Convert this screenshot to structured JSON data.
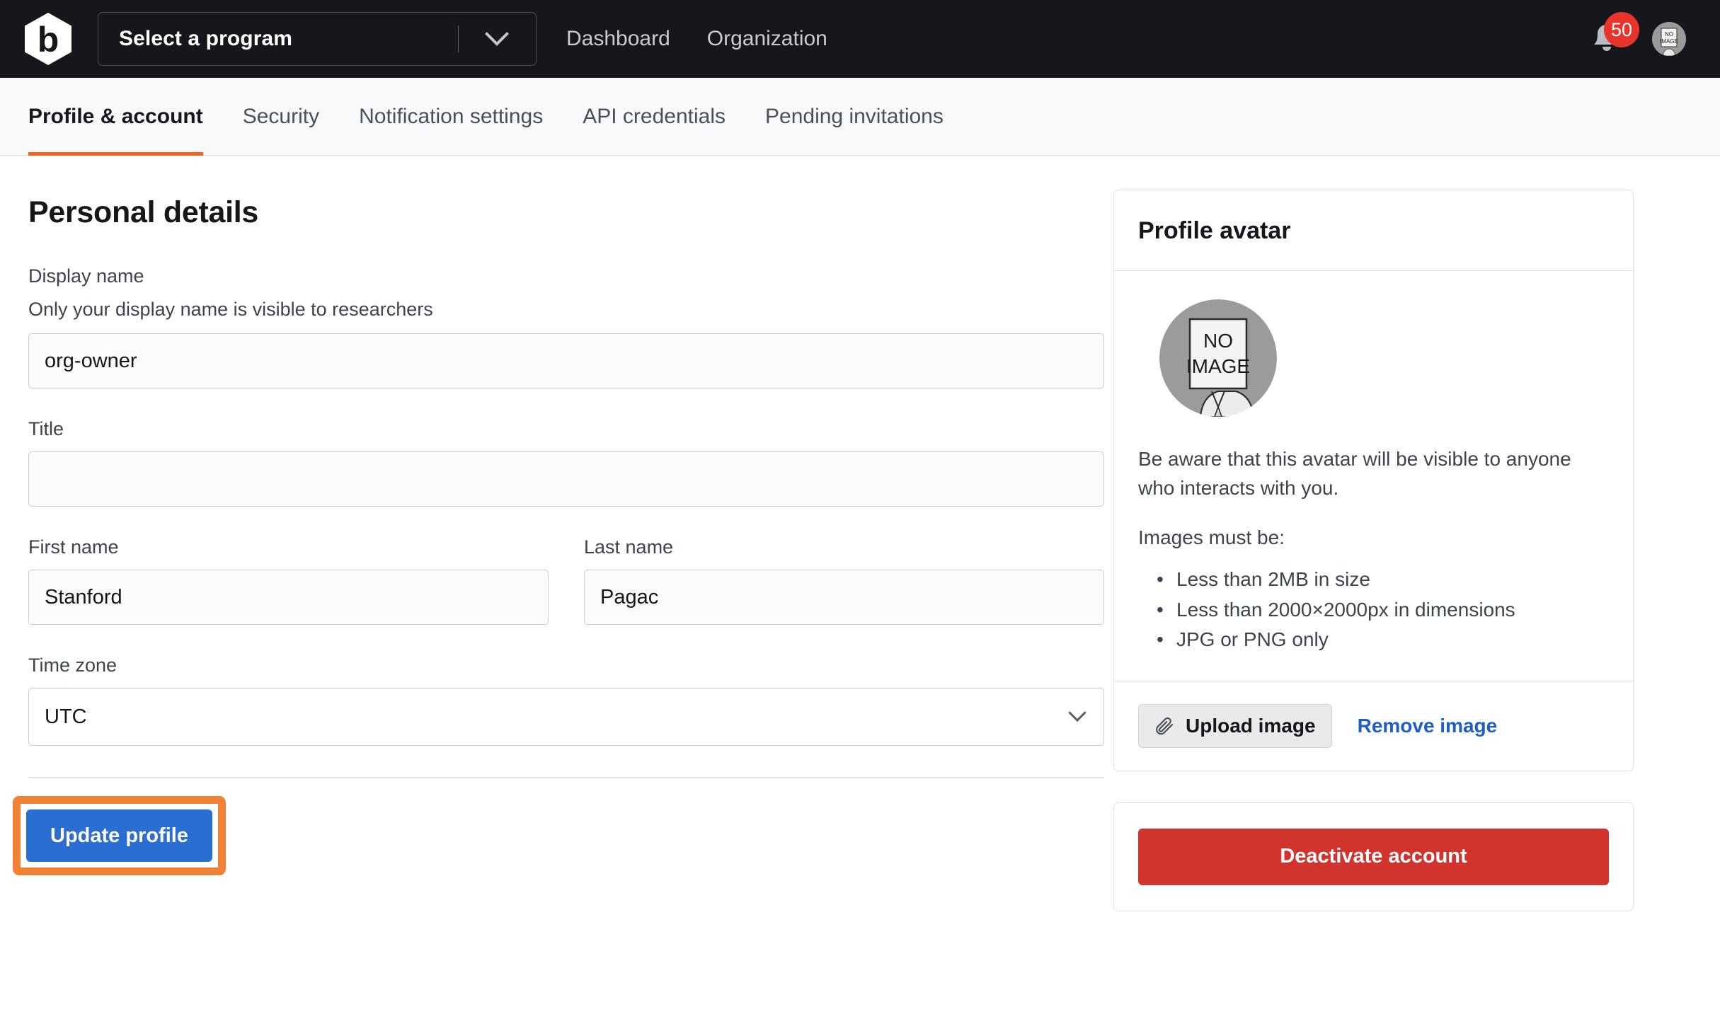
{
  "topbar": {
    "logo_icon": "bugcrowd-hexagon-b-logo",
    "program_select": {
      "label": "Select a program",
      "chevron_icon": "chevron-down-icon"
    },
    "nav": [
      {
        "label": "Dashboard"
      },
      {
        "label": "Organization"
      }
    ],
    "notifications": {
      "icon": "bell-icon",
      "count": "50"
    },
    "avatar": {
      "icon": "user-avatar-no-image",
      "alt_line1": "NO",
      "alt_line2": "IMAGE"
    }
  },
  "tabs": [
    {
      "label": "Profile & account",
      "active": true
    },
    {
      "label": "Security",
      "active": false
    },
    {
      "label": "Notification settings",
      "active": false
    },
    {
      "label": "API credentials",
      "active": false
    },
    {
      "label": "Pending invitations",
      "active": false
    }
  ],
  "accent": {
    "tab_underline": "#f26322",
    "highlight": "#f08135",
    "primary_button": "#2a6ed1",
    "danger_button": "#d0342c",
    "link": "#1f5fc4",
    "badge": "#e8342a"
  },
  "personal_details": {
    "heading": "Personal details",
    "display_name": {
      "label": "Display name",
      "hint": "Only your display name is visible to researchers",
      "value": "org-owner",
      "placeholder": ""
    },
    "title": {
      "label": "Title",
      "value": "",
      "placeholder": ""
    },
    "first_name": {
      "label": "First name",
      "value": "Stanford",
      "placeholder": ""
    },
    "last_name": {
      "label": "Last name",
      "value": "Pagac",
      "placeholder": ""
    },
    "time_zone": {
      "label": "Time zone",
      "value": "UTC",
      "chevron_icon": "chevron-down-icon"
    },
    "submit_label": "Update profile"
  },
  "profile_avatar_card": {
    "heading": "Profile avatar",
    "avatar_icon": "user-avatar-no-image",
    "avatar_text_line1": "NO",
    "avatar_text_line2": "IMAGE",
    "note": "Be aware that this avatar will be visible to anyone who interacts with you.",
    "requirements_intro": "Images must be:",
    "requirements": [
      "Less than 2MB in size",
      "Less than 2000×2000px in dimensions",
      "JPG or PNG only"
    ],
    "upload_label": "Upload image",
    "upload_icon": "paperclip-icon",
    "remove_label": "Remove image"
  },
  "danger_card": {
    "deactivate_label": "Deactivate account"
  }
}
